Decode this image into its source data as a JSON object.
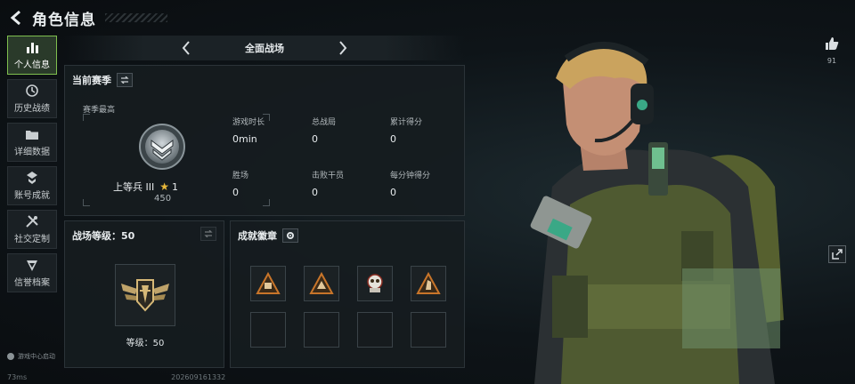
{
  "header": {
    "title": "角色信息"
  },
  "sidebar": {
    "items": [
      {
        "label": "个人信息",
        "icon": "bar-chart-icon",
        "active": true
      },
      {
        "label": "历史战绩",
        "icon": "history-icon"
      },
      {
        "label": "详细数据",
        "icon": "folder-icon"
      },
      {
        "label": "账号成就",
        "icon": "achievement-icon"
      },
      {
        "label": "社交定制",
        "icon": "tools-icon"
      },
      {
        "label": "信誉档案",
        "icon": "shield-icon"
      }
    ],
    "footer": "游戏中心启动"
  },
  "mode": {
    "label": "全面战场"
  },
  "season": {
    "title": "当前赛季",
    "best_label": "赛季最高",
    "rank_name": "上等兵 III",
    "rank_stars": "1",
    "rank_points": "450",
    "stats": [
      {
        "key": "游戏时长",
        "value": "0min"
      },
      {
        "key": "总战局",
        "value": "0"
      },
      {
        "key": "累计得分",
        "value": "0"
      },
      {
        "key": "胜场",
        "value": "0"
      },
      {
        "key": "击败干员",
        "value": "0"
      },
      {
        "key": "每分钟得分",
        "value": "0"
      }
    ]
  },
  "level": {
    "title": "战场等级：50",
    "text": "等级：50"
  },
  "badges": {
    "title": "成就徽章"
  },
  "social": {
    "likes": "91"
  },
  "status": {
    "ping": "73ms",
    "id": "202609161332"
  },
  "colors": {
    "accent": "#7fbf4f",
    "star": "#e8b83a",
    "badge": "#c8752a"
  }
}
